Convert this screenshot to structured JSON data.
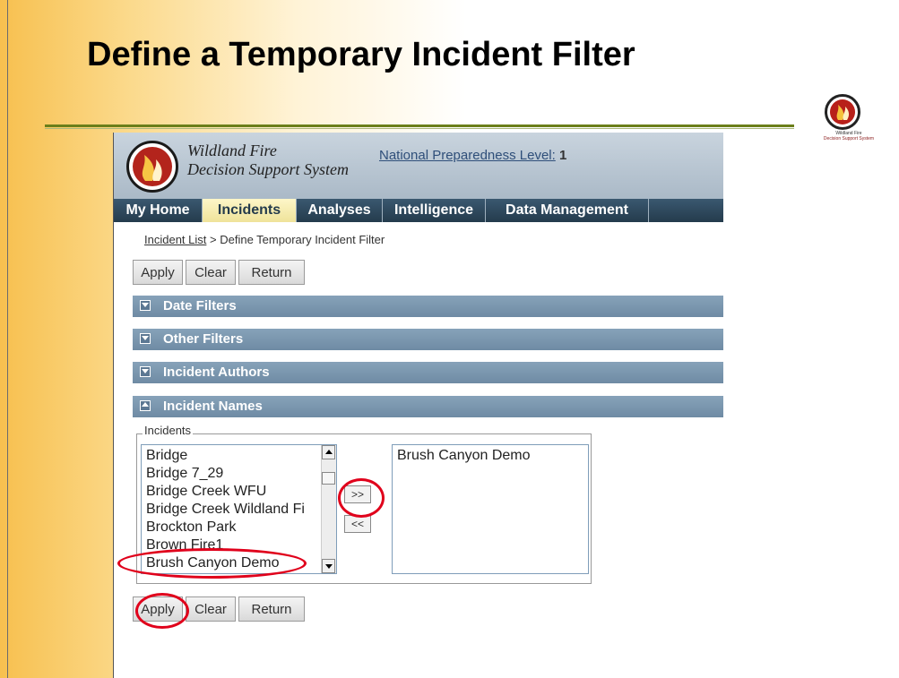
{
  "slide": {
    "title": "Define a Temporary Incident Filter"
  },
  "app": {
    "name_line1": "Wildland Fire",
    "name_line2": "Decision Support System",
    "npl_label": "National Preparedness Level:",
    "npl_value": "1",
    "nav": [
      "My Home",
      "Incidents",
      "Analyses",
      "Intelligence",
      "Data Management"
    ],
    "active_tab": "Incidents",
    "breadcrumb": {
      "link": "Incident List",
      "separator": ">",
      "current": "Define Temporary Incident Filter"
    },
    "buttons": {
      "apply": "Apply",
      "clear": "Clear",
      "return": "Return"
    },
    "sections": [
      "Date Filters",
      "Other Filters",
      "Incident Authors",
      "Incident Names"
    ],
    "incidents_legend": "Incidents",
    "available_incidents": [
      "Bridge",
      "Bridge 7_29",
      "Bridge Creek WFU",
      "Bridge Creek Wildland Fi",
      "Brockton Park",
      "Brown Fire1",
      "Brush Canyon Demo"
    ],
    "selected_incidents": [
      "Brush Canyon Demo"
    ],
    "move_right": ">>",
    "move_left": "<<"
  },
  "colors": {
    "annotation": "#e0001b",
    "nav_bg": "#2f4a5e",
    "section_bg": "#7c97b0"
  }
}
